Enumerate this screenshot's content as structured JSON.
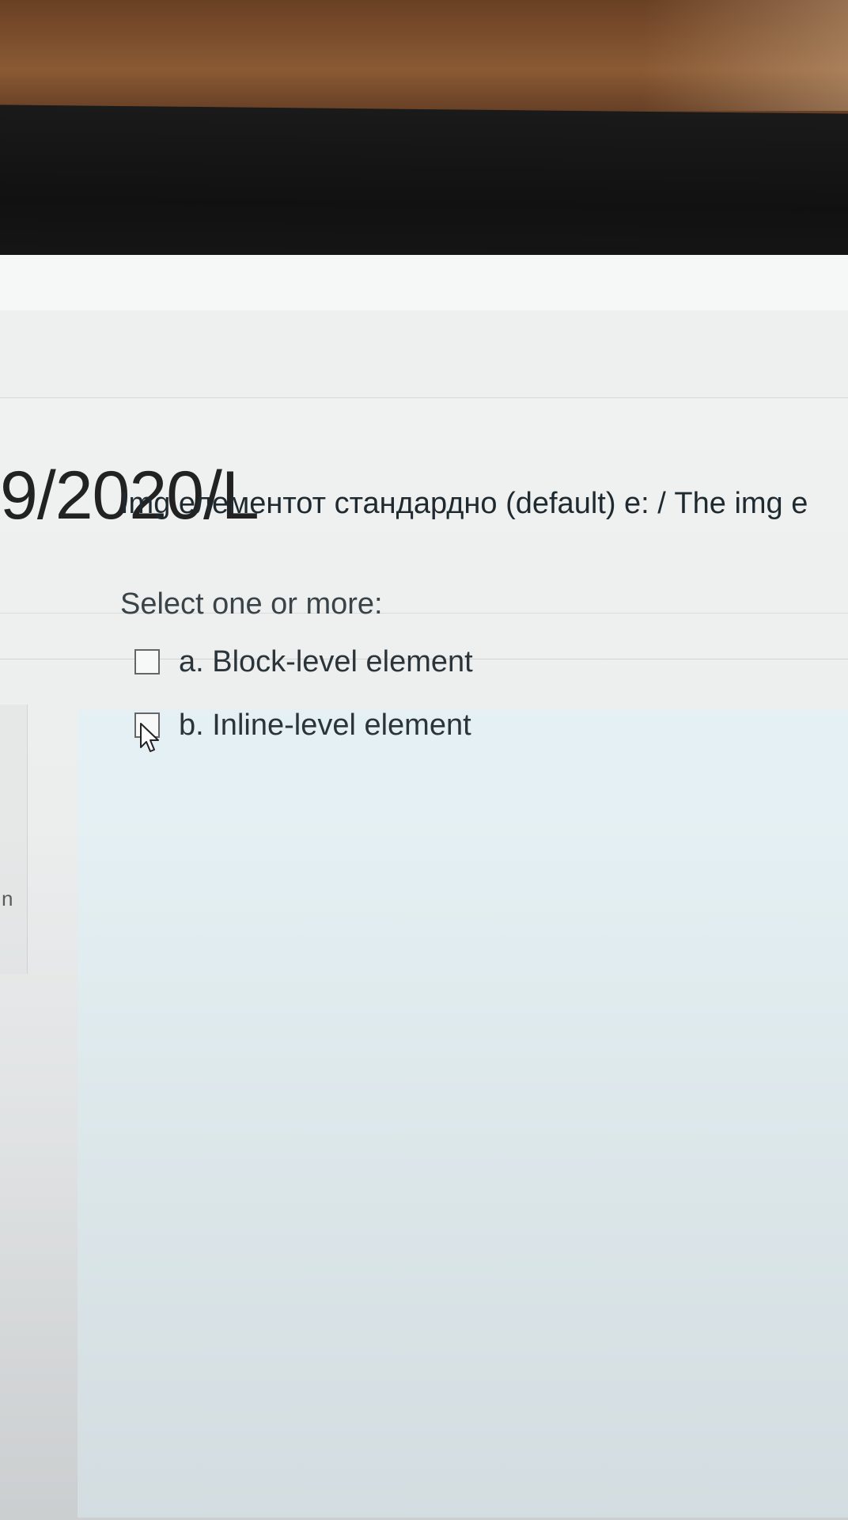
{
  "page": {
    "title": "9/2020/L"
  },
  "side_panel": {
    "fragment_text": "n"
  },
  "question": {
    "text": "Img елементот стандардно (default) е: / The img e",
    "prompt": "Select one or more:",
    "options": [
      {
        "label": "a. Block-level element",
        "checked": false
      },
      {
        "label": "b. Inline-level element",
        "checked": false
      }
    ]
  },
  "icons": {
    "cursor": "mouse-pointer-icon"
  }
}
